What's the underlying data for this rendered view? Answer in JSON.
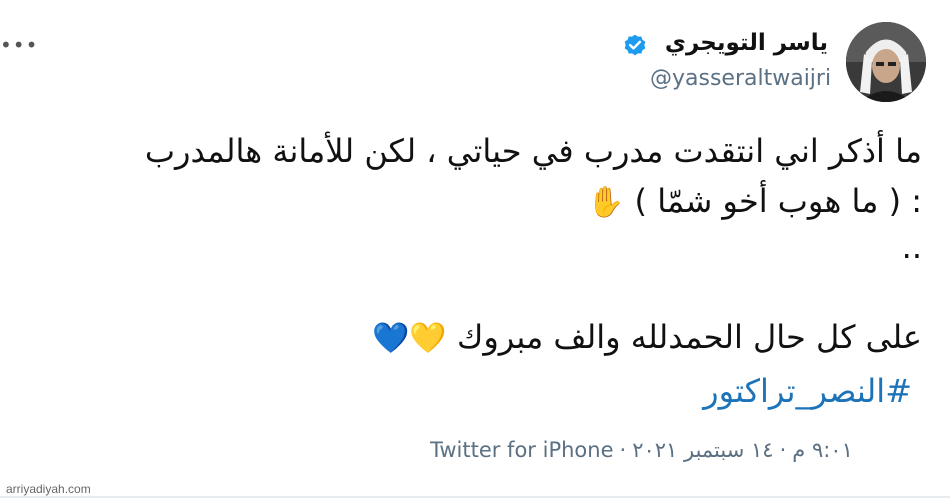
{
  "author": {
    "display_name": "ياسر التويجري",
    "handle": "@yasseraltwaijri",
    "verified": true
  },
  "tweet": {
    "line1": "ما أذكر اني انتقدت مدرب في حياتي ، لكن للأمانة هالمدرب",
    "line2": ": ( ما هوب أخو شمّا )",
    "line2_emoji": "✋",
    "line3": "..",
    "line4": "على كل حال الحمدلله والف مبروك",
    "hearts": [
      "💛",
      "💙"
    ],
    "hashtag": "#النصر_تراكتور"
  },
  "meta": {
    "time": "٩:٠١ م",
    "date": "١٤ سبتمبر ٢٠٢١",
    "source": "Twitter for iPhone"
  },
  "watermark": "arriyadiyah.com",
  "colors": {
    "link": "#1d73b8",
    "verified": "#1d9bf0",
    "secondary_text": "#5b7083",
    "heart_yellow": "#ffc93b",
    "heart_blue": "#3f8ed8"
  },
  "icons": {
    "more": "more-icon",
    "verified": "verified-icon",
    "hand": "raised-hand-emoji"
  }
}
